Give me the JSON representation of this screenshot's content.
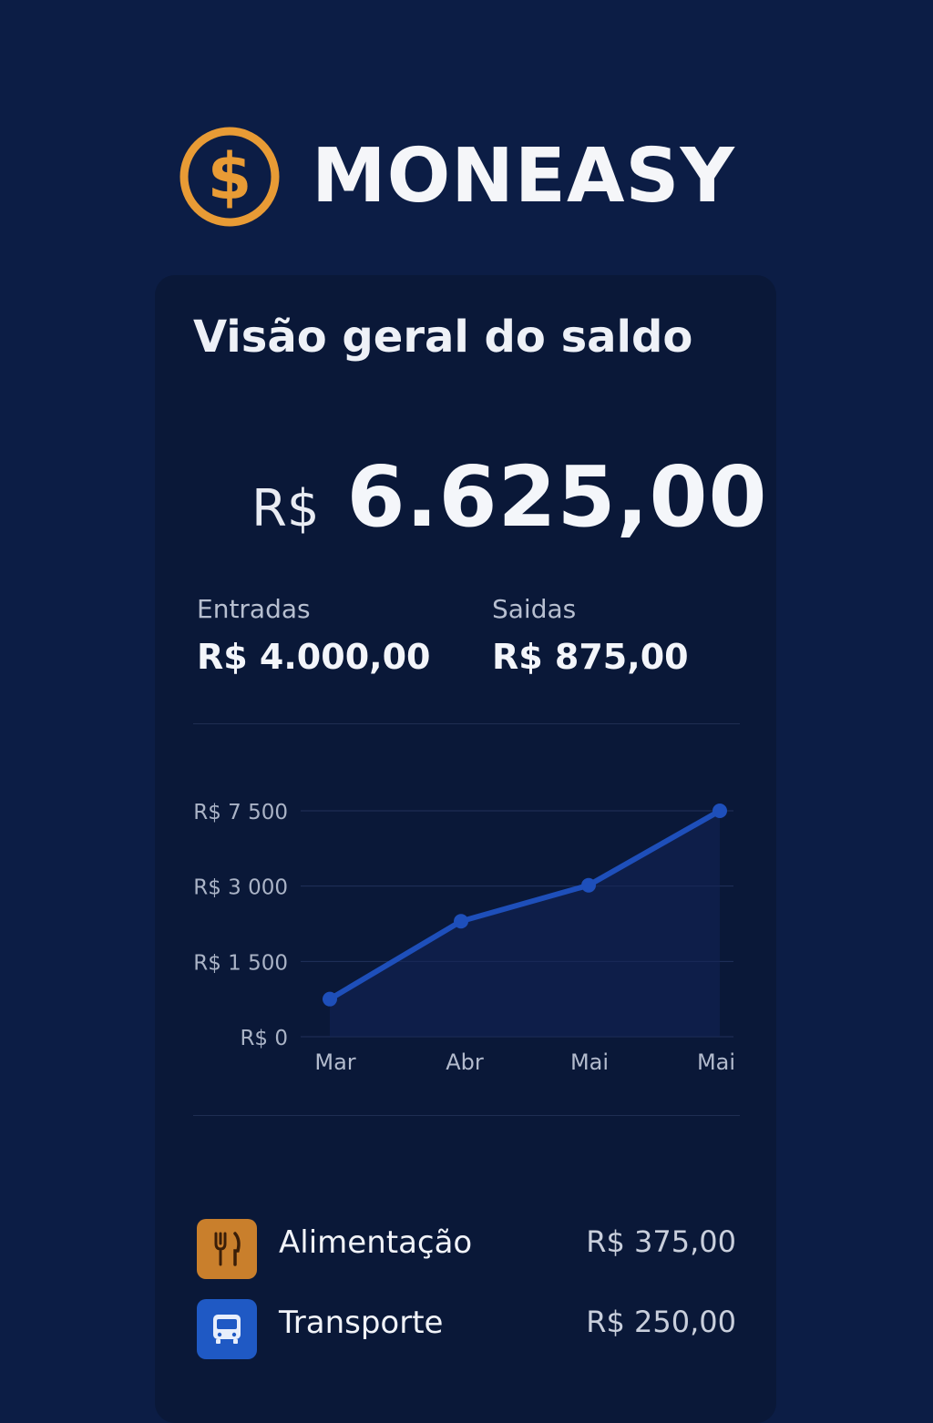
{
  "brand": {
    "name": "MONEASY",
    "logo_icon": "dollar-coin-icon",
    "logo_color": "#e89b35"
  },
  "overview": {
    "title": "Visão geral do saldo",
    "currency": "R$",
    "balance": "6.625,00",
    "income_label": "Entradas",
    "income_value": "R$ 4.000,00",
    "expenses_label": "Saidas",
    "expenses_value": "R$ 875,00"
  },
  "chart_data": {
    "type": "line",
    "categories": [
      "Mar",
      "Abr",
      "Mai",
      "Mai"
    ],
    "y_ticks": [
      0,
      1500,
      3000,
      7500
    ],
    "y_tick_labels": [
      "R$ 0",
      "R$ 1 500",
      "R$ 3 000",
      "R$ 7 500"
    ],
    "series": [
      {
        "values": [
          750,
          2300,
          3050,
          7500
        ],
        "color": "#1e4fba"
      }
    ],
    "grid": true,
    "legend": "none"
  },
  "categories": [
    {
      "label": "Alimentação",
      "amount": "R$ 375,00",
      "icon": "fork-knife-icon",
      "color": "#c97f2c"
    },
    {
      "label": "Transporte",
      "amount": "R$ 250,00",
      "icon": "bus-icon",
      "color": "#1f59c4"
    }
  ]
}
